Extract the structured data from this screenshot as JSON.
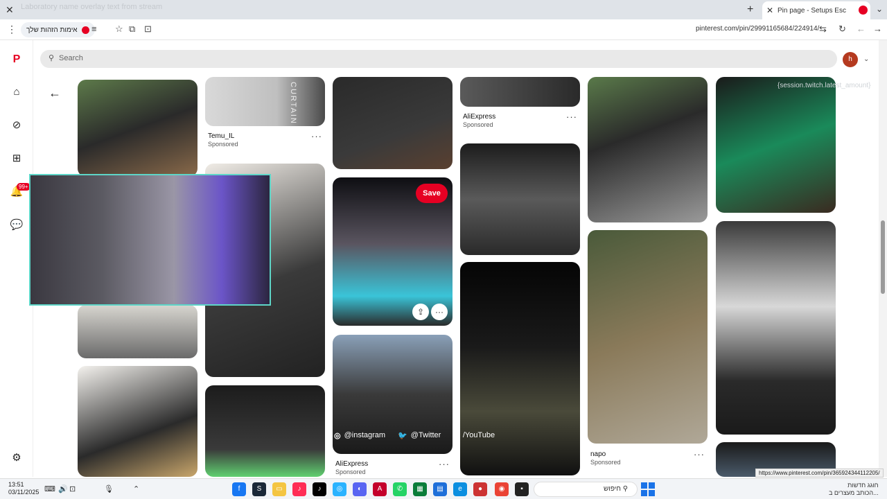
{
  "browser": {
    "tab_title": "Pin page - Setups Esc",
    "url": "pinterest.com/pin/29991165684/224914/",
    "identity_pill": "אימות הזהות שלך",
    "ghost_text": "Laboratory name overlay text from stream",
    "status_url": "https://www.pinterest.com/pin/365924344112205/"
  },
  "pinterest": {
    "search_placeholder": "Search",
    "avatar_letter": "h",
    "notifications_badge": "99+",
    "curtain_text": "CURTAIN",
    "save_label": "Save",
    "pins": [
      {
        "source": "Temu_IL",
        "sponsored": "Sponsored"
      },
      {
        "source": "AliExpress",
        "sponsored": "Sponsored"
      },
      {
        "source": "AliExpress",
        "sponsored": "Sponsored"
      },
      {
        "source": "napo",
        "sponsored": "Sponsored"
      }
    ]
  },
  "stream_overlay": {
    "instagram": "@instagram",
    "twitter": "@Twitter",
    "youtube": "/YouTube",
    "ghost_session": "{session.twitch.latest_amount}"
  },
  "taskbar": {
    "time": "13:51",
    "date": "03/11/2025",
    "search_text": "חיפוש",
    "news_line1": "חוגג חדשות",
    "news_line2": "הכותב מעצרים ב..."
  },
  "colors": {
    "pinterest_red": "#e60023",
    "webcam_border": "#5ed6c8"
  }
}
